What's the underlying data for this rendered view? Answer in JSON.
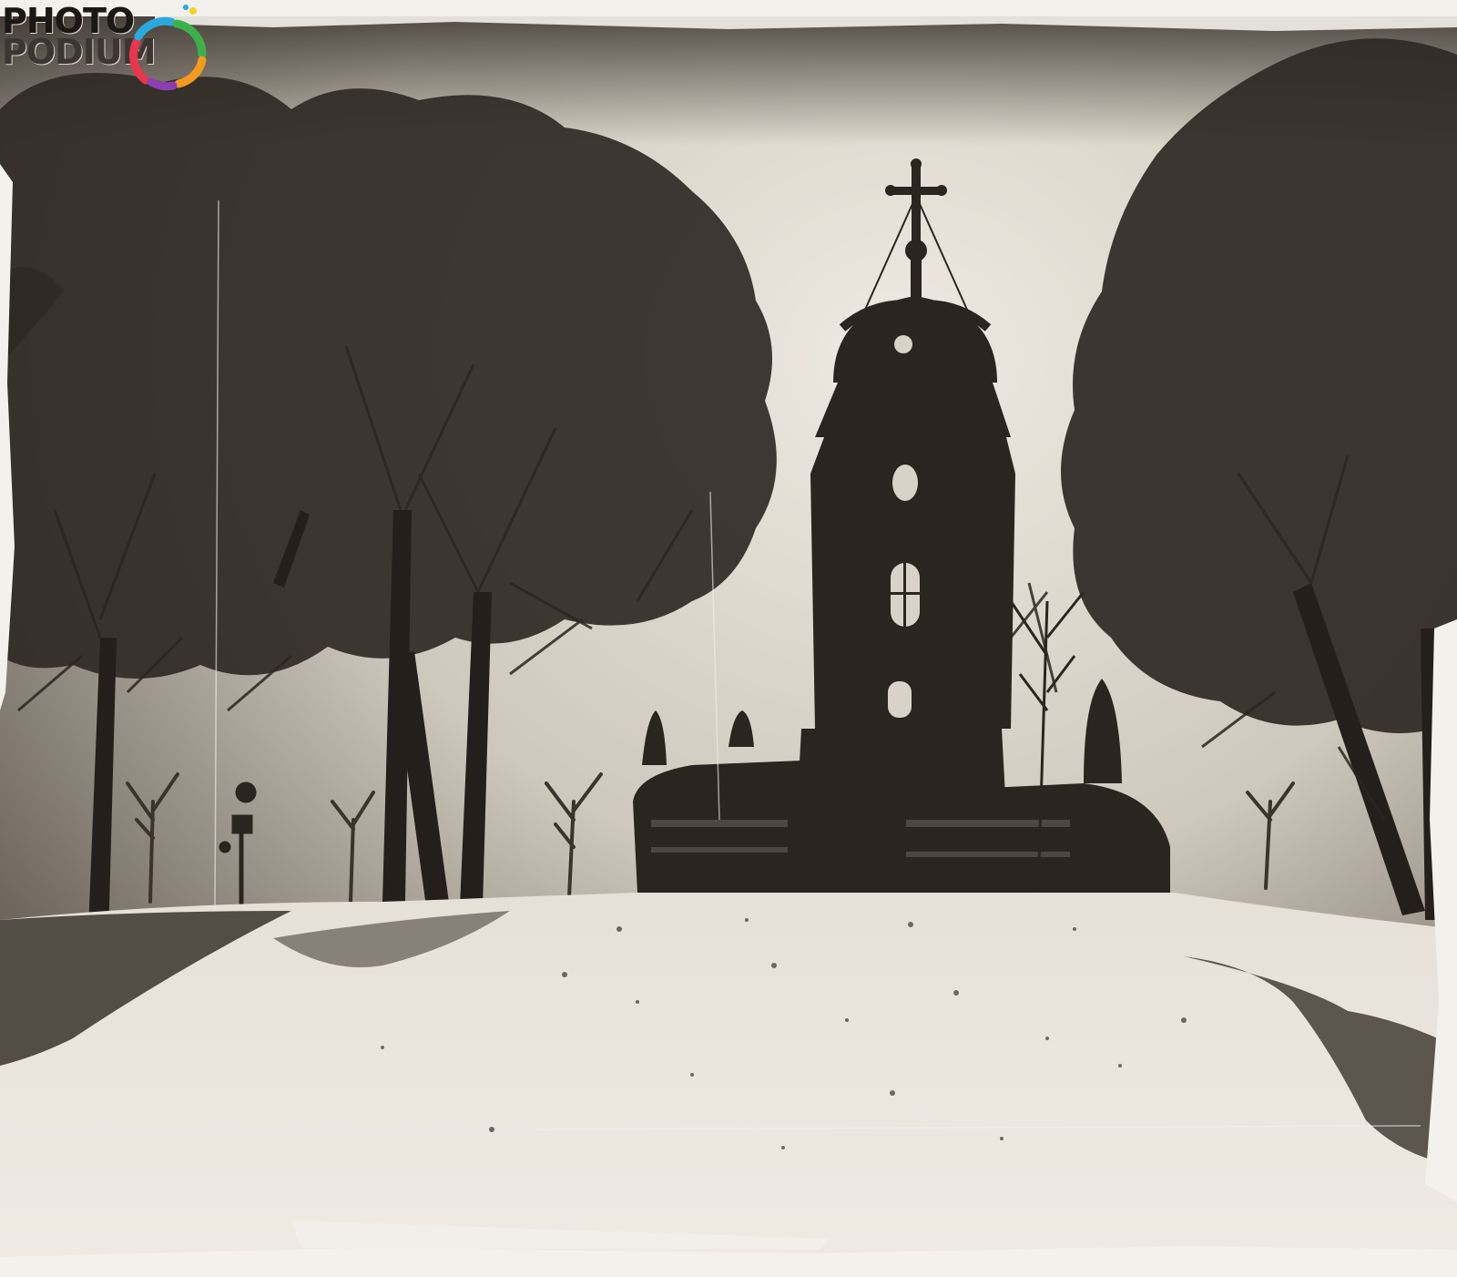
{
  "logo": {
    "line1": "PHOTO",
    "line2": "PODIUM",
    "colors": [
      "#e8364c",
      "#f49a1e",
      "#2aa9df",
      "#8b3fb1",
      "#3cb14a",
      "#f4d22b"
    ]
  },
  "palette": {
    "sky": "#d8d2c8",
    "snow": "#ece8e0",
    "ink": "#2b2520",
    "border": "#f3f1ec"
  }
}
